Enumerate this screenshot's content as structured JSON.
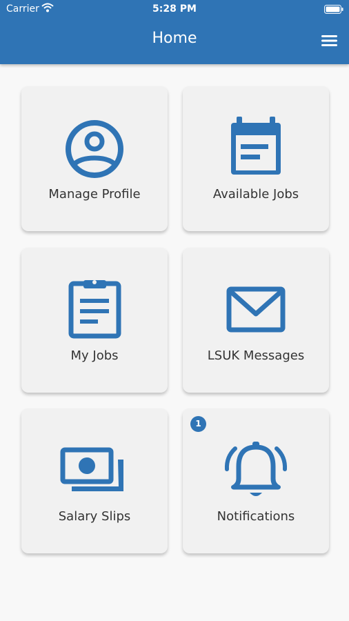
{
  "status_bar": {
    "carrier": "Carrier",
    "time": "5:28 PM"
  },
  "header": {
    "title": "Home"
  },
  "tiles": [
    {
      "label": "Manage Profile",
      "icon": "user-circle-icon"
    },
    {
      "label": "Available Jobs",
      "icon": "calendar-icon"
    },
    {
      "label": "My Jobs",
      "icon": "clipboard-icon"
    },
    {
      "label": "LSUK Messages",
      "icon": "envelope-icon"
    },
    {
      "label": "Salary Slips",
      "icon": "money-icon"
    },
    {
      "label": "Notifications",
      "icon": "bell-icon",
      "badge": "1"
    }
  ],
  "colors": {
    "primary": "#2f74b5",
    "tile_bg": "#f1f1f1",
    "page_bg": "#f8f8f8"
  }
}
